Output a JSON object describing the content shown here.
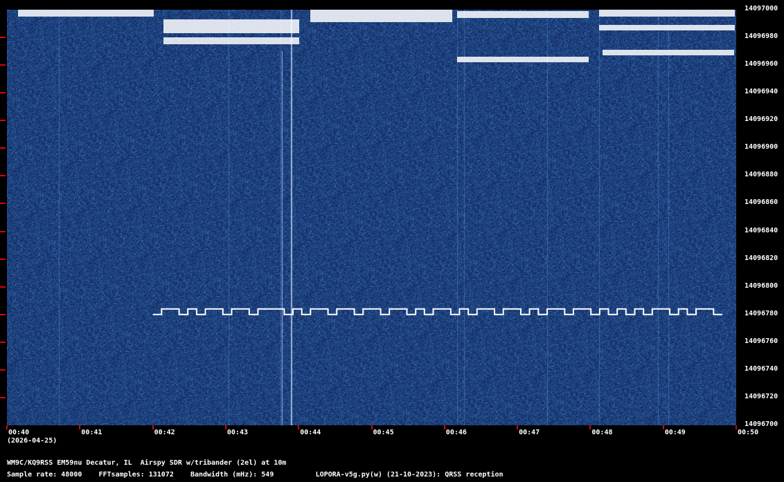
{
  "chart_data": {
    "type": "heatmap",
    "title": "",
    "xlabel": "",
    "ylabel": "",
    "x_ticks": [
      "00:40",
      "00:41",
      "00:42",
      "00:43",
      "00:44",
      "00:45",
      "00:46",
      "00:47",
      "00:48",
      "00:49",
      "00:50"
    ],
    "y_ticks": [
      "14097000",
      "14096980",
      "14096960",
      "14096940",
      "14096920",
      "14096900",
      "14096880",
      "14096860",
      "14096840",
      "14096820",
      "14096800",
      "14096780",
      "14096760",
      "14096740",
      "14096720",
      "14096700"
    ],
    "ylim": [
      14096700,
      14097000
    ],
    "date_label": "(2026-04-25)",
    "colors": {
      "background": "#0a2a6a",
      "signal": "#ffffff",
      "tick": "#e00000"
    },
    "series": [
      {
        "values_note_free": true,
        "frequency_hz": 14096780,
        "start": "00:42",
        "end": "00:50",
        "keying": [
          0,
          1,
          1,
          0,
          1,
          0,
          1,
          1,
          0,
          1,
          1,
          0,
          1,
          1,
          1,
          0,
          1,
          0,
          1,
          1,
          0,
          1,
          1,
          0,
          1,
          1,
          0,
          1,
          1,
          0,
          1,
          0,
          1,
          1,
          0,
          1,
          0,
          1,
          1,
          0,
          1,
          1,
          0,
          1,
          0,
          1,
          1,
          0,
          1,
          1,
          0,
          1,
          0,
          1,
          0,
          1,
          0,
          1,
          1,
          0,
          1,
          0,
          1,
          1,
          0
        ]
      }
    ]
  },
  "footer": {
    "station": "WM9C/KQ9RSS EM59nu Decatur, IL  Airspy SDR w/tribander (2el) at 10m",
    "sample_rate": "Sample rate: 48000",
    "fft": "FFTsamples: 131072",
    "bandwidth": "Bandwidth (mHz): 549",
    "software": "LOPORA-v5g.py(w) (21-10-2023): QRSS reception"
  }
}
